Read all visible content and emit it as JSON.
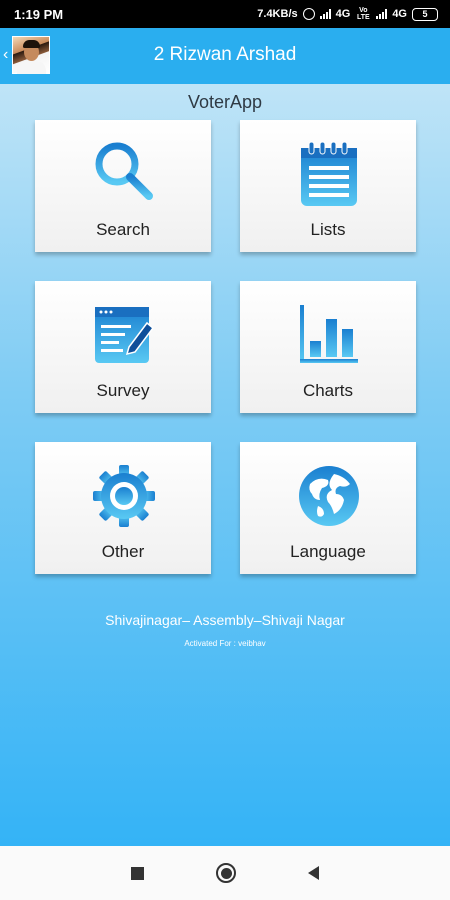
{
  "status_bar": {
    "time": "1:19 PM",
    "net_speed": "7.4KB/s",
    "network_1": "4G",
    "volte": "Vo LTE",
    "network_2": "4G",
    "battery": "5"
  },
  "header": {
    "title": "2 Rizwan Arshad"
  },
  "main": {
    "app_name": "VoterApp",
    "tiles": [
      {
        "label": "Search",
        "icon": "search-icon"
      },
      {
        "label": "Lists",
        "icon": "notepad-icon"
      },
      {
        "label": "Survey",
        "icon": "survey-icon"
      },
      {
        "label": "Charts",
        "icon": "bar-chart-icon"
      },
      {
        "label": "Other",
        "icon": "gear-icon"
      },
      {
        "label": "Language",
        "icon": "globe-icon"
      }
    ],
    "location": "Shivajinagar– Assembly–Shivaji Nagar",
    "activated_for": "Activated For : veibhav"
  },
  "colors": {
    "header": "#2aaeef",
    "icon_dark": "#1a7fd0",
    "icon_light": "#59c9f3"
  }
}
